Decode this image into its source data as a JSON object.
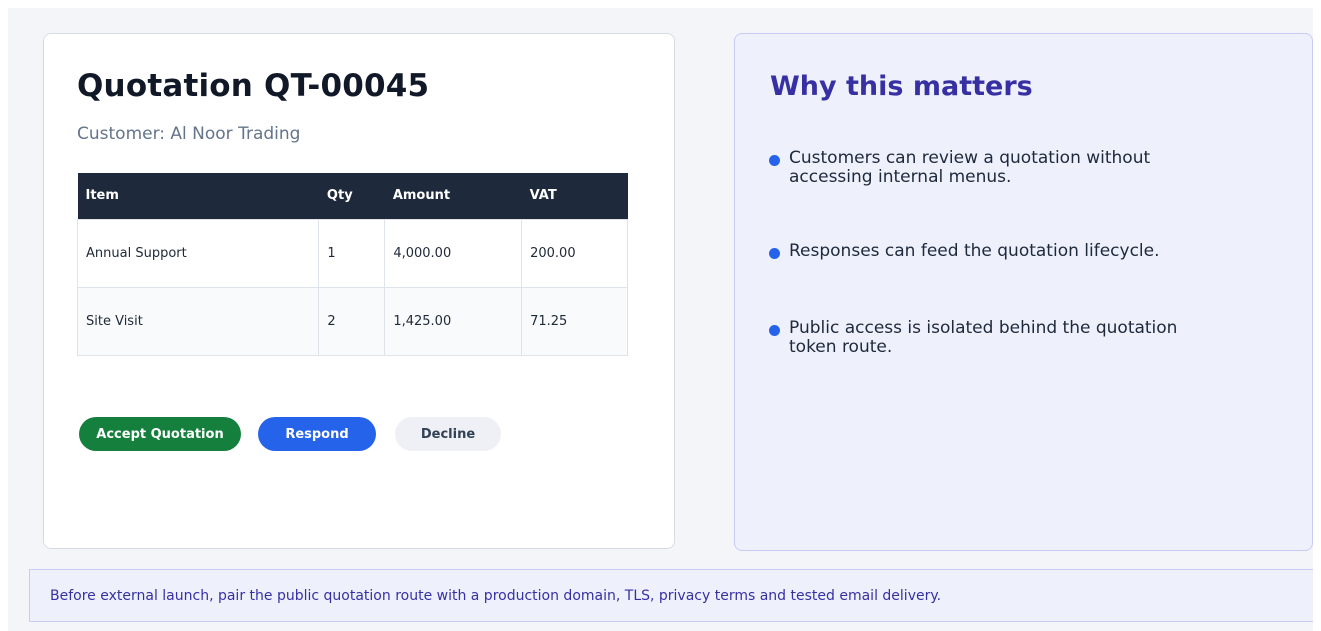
{
  "quotation": {
    "title": "Quotation QT-00045",
    "customer": "Customer: Al Noor Trading",
    "table": {
      "headers": [
        "Item",
        "Qty",
        "Amount",
        "VAT"
      ],
      "rows": [
        [
          "Annual Support",
          "1",
          "4,000.00",
          "200.00"
        ],
        [
          "Site Visit",
          "2",
          "1,425.00",
          "71.25"
        ]
      ]
    },
    "actions": {
      "accept_label": "Accept Quotation",
      "respond_label": "Respond",
      "decline_label": "Decline"
    }
  },
  "info_panel": {
    "title": "Why this matters",
    "points": [
      "Customers can review a quotation without accessing internal menus.",
      "Responses can feed the quotation lifecycle.",
      "Public access is isolated behind the quotation token route."
    ]
  },
  "footer_note": "Before external launch, pair the public quotation route with a production domain, TLS, privacy terms and tested email delivery.",
  "colors": {
    "accept": "#15803d",
    "respond": "#2563eb",
    "decline": "#eef0f5",
    "accent": "#3730a3",
    "table_header": "#1e293b"
  }
}
